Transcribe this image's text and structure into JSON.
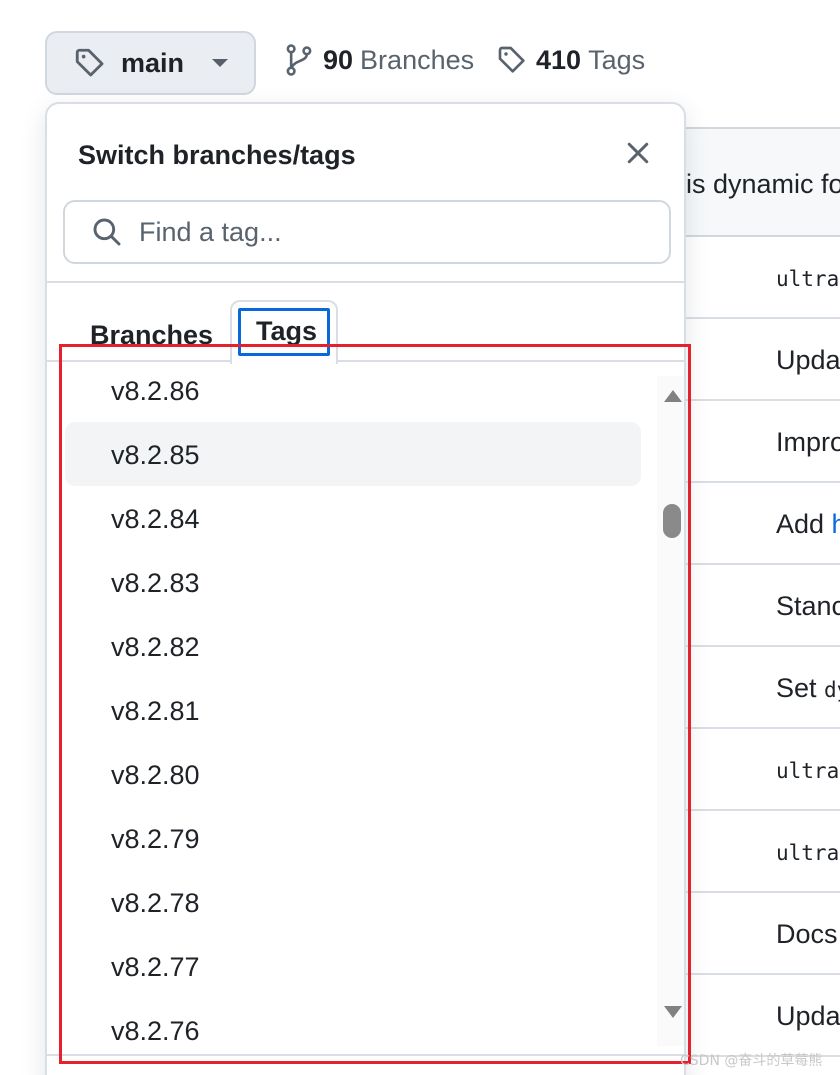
{
  "ref_selector": {
    "current": "main"
  },
  "repo_meta": {
    "branches_count": "90",
    "branches_word": "Branches",
    "tags_count": "410",
    "tags_word": "Tags"
  },
  "background_list": {
    "header_text": "is dynamic fo",
    "rows": [
      {
        "text": "ultra",
        "mono": true
      },
      {
        "text": "Upda",
        "mono": false
      },
      {
        "text": "Impro",
        "mono": false
      },
      {
        "text": "Add ",
        "link": "h",
        "mono": false
      },
      {
        "text": "Stanc",
        "mono": false
      },
      {
        "text": "Set ",
        "mono_suffix": "dy",
        "mono": false
      },
      {
        "text": "ultra",
        "mono": true
      },
      {
        "text": "ultra",
        "mono": true
      },
      {
        "text": "Docs",
        "mono": false
      },
      {
        "text": "Upda",
        "mono": false
      }
    ]
  },
  "dropdown": {
    "title": "Switch branches/tags",
    "search_placeholder": "Find a tag...",
    "tabs": {
      "branches": "Branches",
      "tags": "Tags",
      "active": "Tags"
    },
    "tags": [
      "v8.2.86",
      "v8.2.85",
      "v8.2.84",
      "v8.2.83",
      "v8.2.82",
      "v8.2.81",
      "v8.2.80",
      "v8.2.79",
      "v8.2.78",
      "v8.2.77",
      "v8.2.76"
    ],
    "highlighted_tag": "v8.2.85"
  },
  "watermark": "CSDN @奋斗的草莓熊",
  "colors": {
    "annotation_red": "#e5212d",
    "focus_blue": "#0969da"
  }
}
